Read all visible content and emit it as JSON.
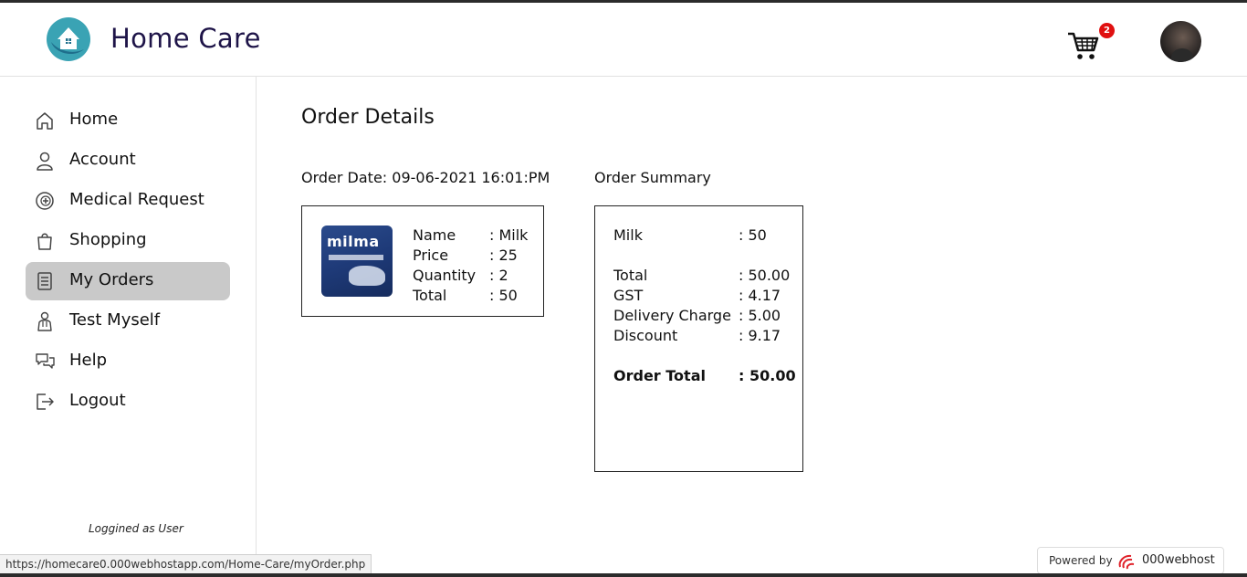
{
  "header": {
    "brand": "Home Care",
    "cart_count": "2"
  },
  "sidebar": {
    "items": [
      {
        "label": "Home",
        "icon": "home-icon"
      },
      {
        "label": "Account",
        "icon": "user-icon"
      },
      {
        "label": "Medical Request",
        "icon": "medical-icon"
      },
      {
        "label": "Shopping",
        "icon": "shopping-bag-icon"
      },
      {
        "label": "My Orders",
        "icon": "orders-icon",
        "active": true
      },
      {
        "label": "Test Myself",
        "icon": "doctor-icon"
      },
      {
        "label": "Help",
        "icon": "chat-icon"
      },
      {
        "label": "Logout",
        "icon": "logout-icon"
      }
    ],
    "logged_as": "Loggined as User"
  },
  "main": {
    "title": "Order Details",
    "order_date": "Order Date: 09-06-2021 16:01:PM",
    "summary_title": "Order Summary",
    "item": {
      "image_brand": "milma",
      "rows": [
        {
          "key": "Name",
          "value": ": Milk"
        },
        {
          "key": "Price",
          "value": ": 25"
        },
        {
          "key": "Quantity",
          "value": ": 2"
        },
        {
          "key": "Total",
          "value": ": 50"
        }
      ]
    },
    "summary": {
      "line_item": {
        "key": "Milk",
        "value": ": 50"
      },
      "rows": [
        {
          "key": "Total",
          "value": ": 50.00"
        },
        {
          "key": "GST",
          "value": ": 4.17"
        },
        {
          "key": "Delivery Charge",
          "value": ": 5.00"
        },
        {
          "key": "Discount",
          "value": ": 9.17"
        }
      ],
      "order_total": {
        "key": "Order Total",
        "value": ": 50.00"
      }
    }
  },
  "status_bar": {
    "url": "https://homecare0.000webhostapp.com/Home-Care/myOrder.php"
  },
  "powered": {
    "label": "Powered by",
    "name": "000webhost"
  },
  "colors": {
    "brand_text": "#1e1448",
    "active_nav": "#c9c9c9",
    "badge": "#e01010"
  }
}
